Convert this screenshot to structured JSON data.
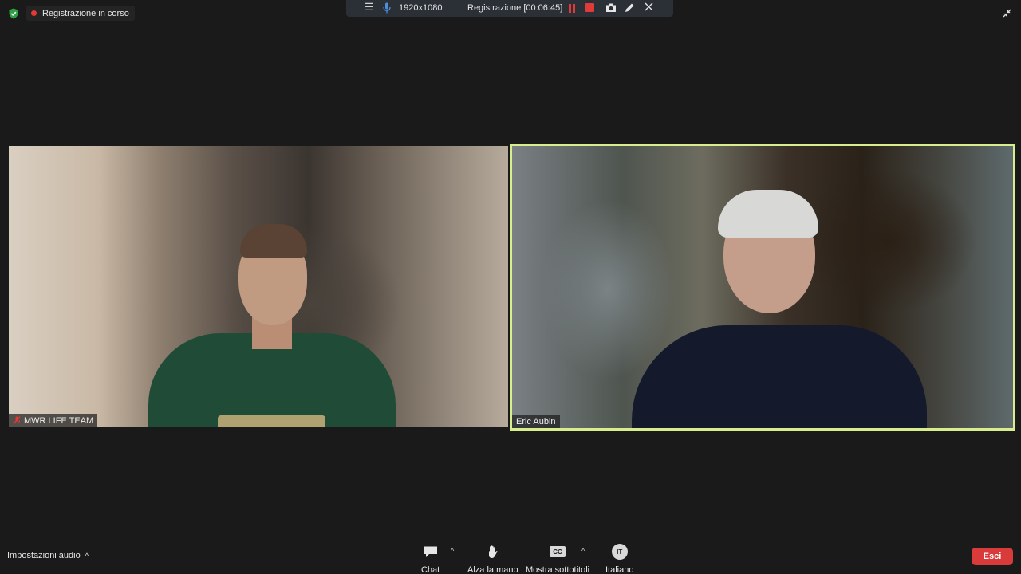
{
  "status": {
    "recording_label": "Registrazione in corso",
    "shield_icon": "shield-check-icon",
    "accent_green": "#2ea043",
    "rec_dot_color": "#e53935"
  },
  "recorder": {
    "menu_icon": "hamburger-icon",
    "mic_icon": "microphone-icon",
    "resolution": "1920x1080",
    "timer": "Registrazione [00:06:45]",
    "pause_icon": "pause-icon",
    "stop_icon": "stop-icon",
    "camera_icon": "camera-icon",
    "pen_icon": "pen-icon",
    "close_icon": "close-icon"
  },
  "window": {
    "shrink_icon": "exit-fullscreen-icon"
  },
  "participants": [
    {
      "name": "MWR LIFE TEAM",
      "muted": true,
      "active_speaker": false
    },
    {
      "name": "Eric Aubin",
      "muted": false,
      "active_speaker": true
    }
  ],
  "active_speaker_color": "#d8ee8e",
  "toolbar": {
    "audio_settings": "Impostazioni audio",
    "chat": "Chat",
    "raise_hand": "Alza la mano",
    "captions": "Mostra sottotitoli",
    "captions_icon_text": "CC",
    "language": "Italiano",
    "language_icon_text": "IT",
    "exit": "Esci",
    "exit_color": "#d93a3a"
  }
}
